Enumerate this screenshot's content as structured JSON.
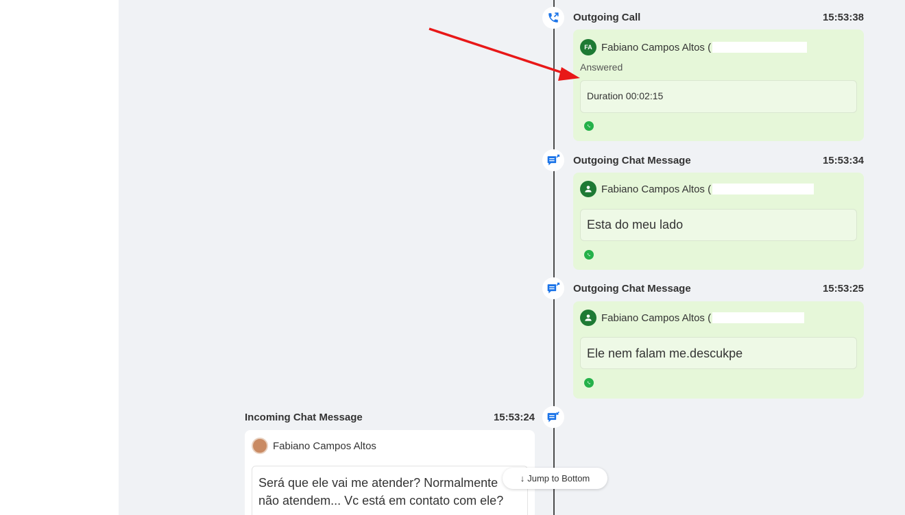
{
  "events": [
    {
      "type_label": "Outgoing Call",
      "time": "15:53:38",
      "icon": "outgoing-call-icon",
      "sender_initials": "FA",
      "sender_name": "Fabiano Campos Altos (",
      "status": "Answered",
      "detail": "Duration 00:02:15",
      "channel": "whatsapp"
    },
    {
      "type_label": "Outgoing Chat Message",
      "time": "15:53:34",
      "icon": "outgoing-chat-icon",
      "sender_name": "Fabiano Campos Altos (",
      "message": "Esta do meu lado",
      "channel": "whatsapp"
    },
    {
      "type_label": "Outgoing Chat Message",
      "time": "15:53:25",
      "icon": "outgoing-chat-icon",
      "sender_name": "Fabiano Campos Altos (",
      "message": "Ele nem falam me.descukpe",
      "channel": "whatsapp"
    },
    {
      "type_label": "Incoming Chat Message",
      "time": "15:53:24",
      "icon": "incoming-chat-icon",
      "sender_name": "Fabiano Campos Altos",
      "message": "Será que ele vai me atender? Normalmente não atendem... Vc está em contato com ele?"
    }
  ],
  "jump_to_bottom": {
    "label": "Jump to Bottom",
    "arrow": "↓"
  },
  "colors": {
    "outgoing_card": "#e6f7d9",
    "accent_blue": "#1a73e8",
    "whatsapp_green": "#25b14a",
    "annotation_arrow": "#e81818"
  }
}
